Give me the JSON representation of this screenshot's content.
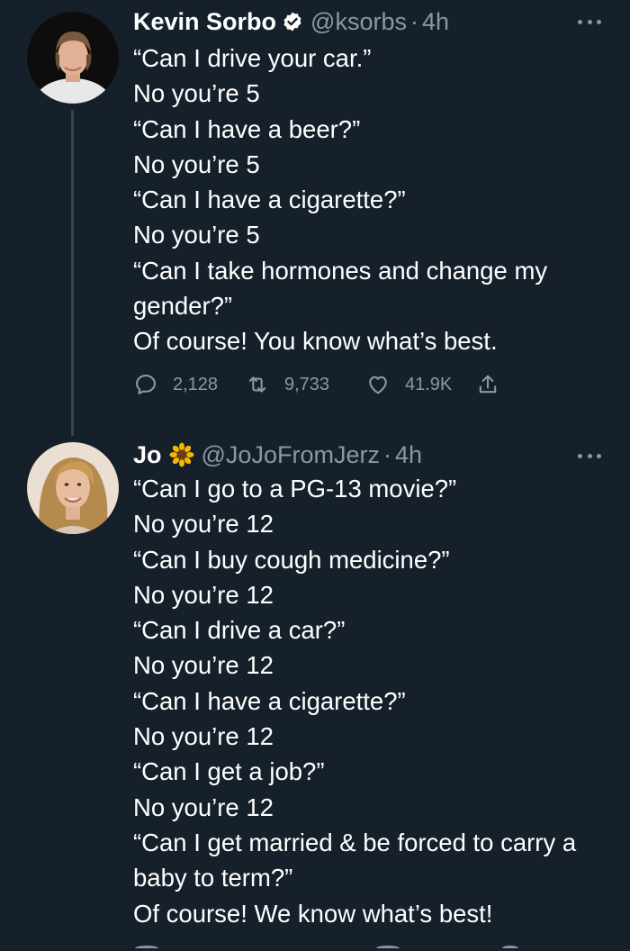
{
  "tweets": [
    {
      "display_name": "Kevin Sorbo",
      "verified": true,
      "handle": "@ksorbs",
      "separator": "·",
      "time": "4h",
      "lines": [
        "“Can I drive your car.”",
        "No you’re 5",
        "“Can I have a beer?”",
        "No you’re 5",
        "“Can I have a cigarette?”",
        "No you’re 5",
        "“Can I take hormones and change my gender?”",
        "Of course! You know what’s best."
      ],
      "actions": {
        "reply_count": "2,128",
        "retweet_count": "9,733",
        "like_count": "41.9K"
      }
    },
    {
      "display_name": "Jo",
      "emoji": "sunflower-icon",
      "handle": "@JoJoFromJerz",
      "separator": "·",
      "time": "4h",
      "lines": [
        "“Can I go to a PG-13 movie?”",
        "No you’re 12",
        "“Can I buy cough medicine?”",
        "No you’re 12",
        "“Can I drive a car?”",
        "No you’re 12",
        "“Can I have a cigarette?”",
        "No you’re 12",
        "“Can I get a job?”",
        "No you’re 12",
        "“Can I get married & be forced to carry a baby to term?”",
        "Of course! We know what’s best!"
      ]
    }
  ],
  "colors": {
    "background": "#15202b",
    "text": "#ffffff",
    "secondary": "#8899a6",
    "verified": "#ffffff",
    "thread_line": "#38444d"
  }
}
